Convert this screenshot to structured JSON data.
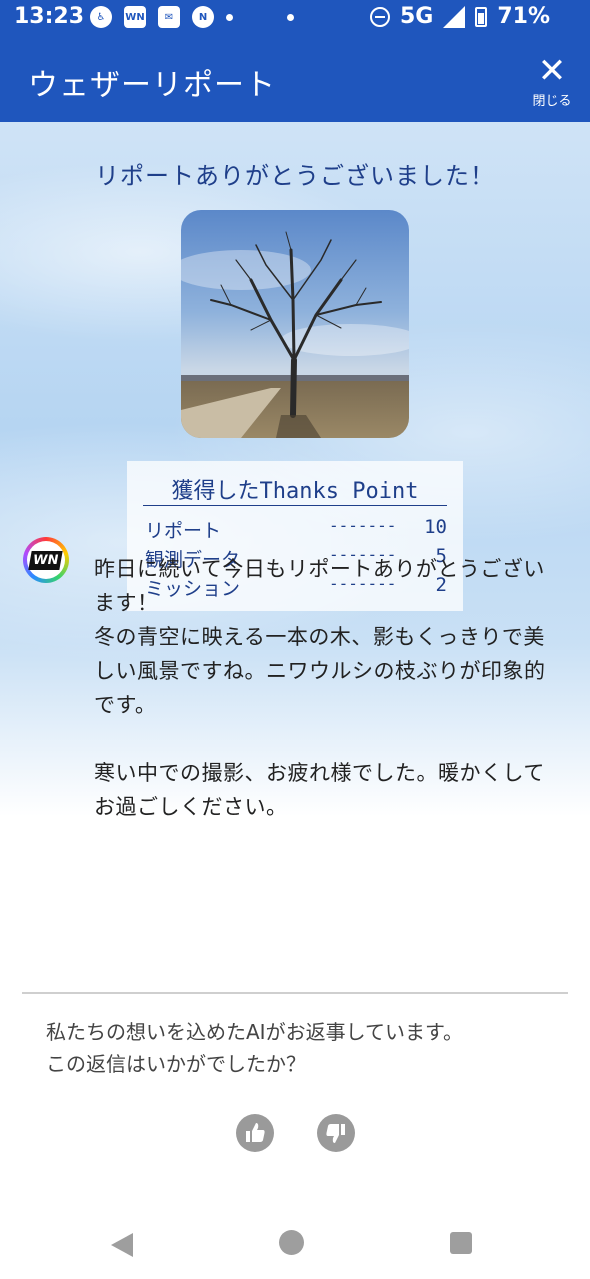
{
  "status_bar": {
    "time": "13:23",
    "network": "5G",
    "battery": "71%",
    "icons": [
      "accessibility-icon",
      "wni-icon",
      "mail-icon",
      "nhk-icon",
      "dot-icon",
      "dot-icon",
      "do-not-disturb-icon",
      "signal-icon",
      "battery-icon"
    ]
  },
  "app_bar": {
    "title": "ウェザーリポート",
    "close_label": "閉じる"
  },
  "main": {
    "thanks_title": "リポートありがとうございました！",
    "points": {
      "title": "獲得したThanks Point",
      "rows": [
        {
          "label": "リポート",
          "dashes": "-------",
          "value": "10"
        },
        {
          "label": "観測データ",
          "dashes": "-------",
          "value": "5"
        },
        {
          "label": "ミッション",
          "dashes": "-------",
          "value": "2"
        }
      ]
    },
    "avatar_text": "WN",
    "message": {
      "p1": "昨日に続いて今日もリポートありがとうございます！",
      "p2": "冬の青空に映える一本の木、影もくっきりで美しい風景ですね。ニワウルシの枝ぶりが印象的です。",
      "p3": "寒い中での撮影、お疲れ様でした。暖かくしてお過ごしください。"
    }
  },
  "feedback": {
    "line1": "私たちの想いを込めたAIがお返事しています。",
    "line2": "この返信はいかがでしたか？"
  },
  "colors": {
    "primary": "#1f56bd",
    "text_blue": "#1f3f8a"
  }
}
